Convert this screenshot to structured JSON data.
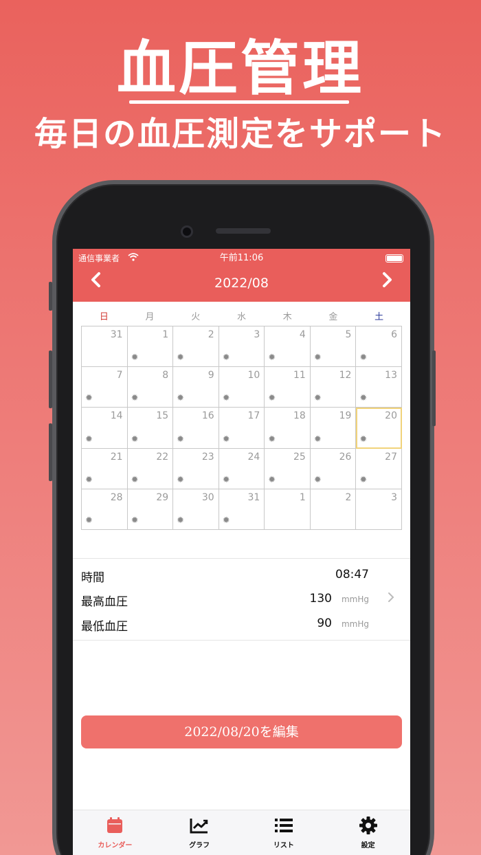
{
  "promo": {
    "title": "血圧管理",
    "subtitle": "毎日の血圧測定をサポート"
  },
  "status_bar": {
    "carrier": "通信事業者",
    "time": "午前11:06"
  },
  "header": {
    "month": "2022/08",
    "prev": "‹",
    "next": "›"
  },
  "weekdays": [
    "日",
    "月",
    "火",
    "水",
    "木",
    "金",
    "土"
  ],
  "calendar": {
    "days": [
      "31",
      "1",
      "2",
      "3",
      "4",
      "5",
      "6",
      "7",
      "8",
      "9",
      "10",
      "11",
      "12",
      "13",
      "14",
      "15",
      "16",
      "17",
      "18",
      "19",
      "20",
      "21",
      "22",
      "23",
      "24",
      "25",
      "26",
      "27",
      "28",
      "29",
      "30",
      "31",
      "1",
      "2",
      "3"
    ],
    "mark_symbol": "✹",
    "today_index": 20
  },
  "detail": {
    "time_label": "時間",
    "time_value": "08:47",
    "high_label": "最高血圧",
    "high_value": "130",
    "high_unit": "mmHg",
    "low_label": "最低血圧",
    "low_value": "90",
    "low_unit": "mmHg"
  },
  "edit_button": "2022/08/20を編集",
  "tabs": [
    {
      "label": "カレンダー",
      "icon": "calendar-icon"
    },
    {
      "label": "グラフ",
      "icon": "chart-icon"
    },
    {
      "label": "リスト",
      "icon": "list-icon"
    },
    {
      "label": "設定",
      "icon": "gear-icon"
    }
  ],
  "colors": {
    "accent": "#e95e5b",
    "button": "#ef716c",
    "sunday": "#d23b35",
    "saturday": "#2b3a9a",
    "today_border": "#f1d37a"
  }
}
